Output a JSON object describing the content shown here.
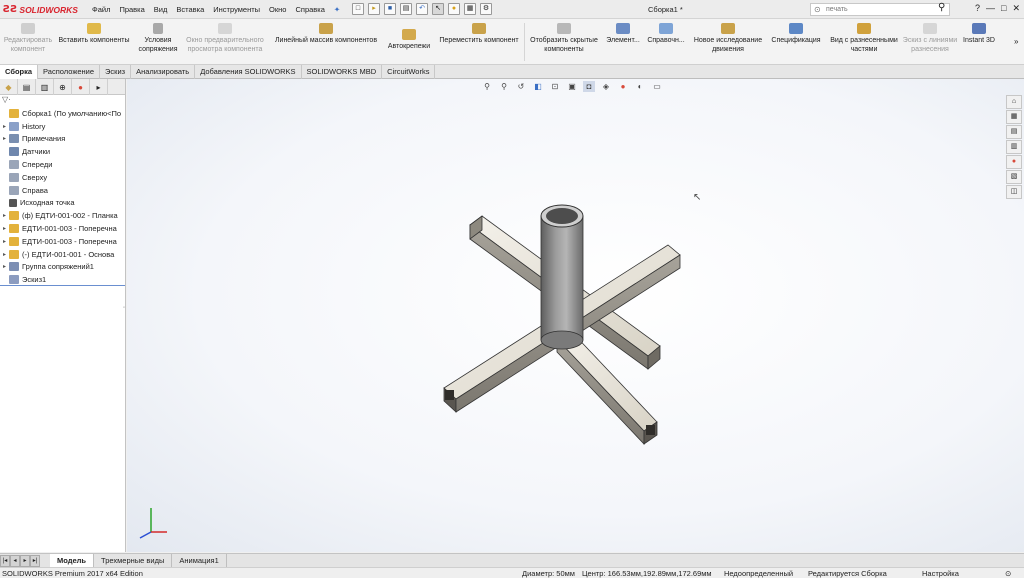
{
  "app": {
    "logo_text": "SOLIDWORKS",
    "doc_title": "Сборка1 *"
  },
  "menu": [
    "Файл",
    "Правка",
    "Вид",
    "Вставка",
    "Инструменты",
    "Окно",
    "Справка"
  ],
  "search": {
    "placeholder": "печать"
  },
  "window_controls": {
    "help": "?",
    "minimize": "—",
    "restore": "□",
    "close": "✕"
  },
  "ribbon": {
    "edit_component": "Редактировать компонент",
    "insert_components": "Вставить компоненты",
    "mate": "Условия сопряжения",
    "preview_window": "Окно предварительного просмотра компонента",
    "linear_pattern": "Линейный массив компонентов",
    "smart_fasteners": "Автокрепежи",
    "move_component": "Переместить компонент",
    "show_hidden": "Отобразить скрытые компоненты",
    "elements": "Элемент...",
    "reference": "Справочн...",
    "new_motion": "Новое исследование движения",
    "bom": "Спецификация",
    "exploded_view": "Вид с разнесенными частями",
    "explode_line": "Эскиз с линиями разнесения",
    "instant3d": "Instant 3D"
  },
  "command_tabs": [
    "Сборка",
    "Расположение",
    "Эскиз",
    "Анализировать",
    "Добавления SOLIDWORKS",
    "SOLIDWORKS MBD",
    "CircuitWorks"
  ],
  "tree": [
    {
      "label": "Сборка1  (По умолчанию<По",
      "arrow": "",
      "color": "#e3b23c"
    },
    {
      "label": "History",
      "arrow": "▸",
      "color": "#8aa0c8"
    },
    {
      "label": "Примечания",
      "arrow": "▸",
      "color": "#7a8fb0"
    },
    {
      "label": "Датчики",
      "arrow": "",
      "color": "#6f87ad"
    },
    {
      "label": "Спереди",
      "arrow": "",
      "color": "#9aa5b8"
    },
    {
      "label": "Сверху",
      "arrow": "",
      "color": "#9aa5b8"
    },
    {
      "label": "Справа",
      "arrow": "",
      "color": "#9aa5b8"
    },
    {
      "label": "Исходная точка",
      "arrow": "",
      "color": "#555555"
    },
    {
      "label": "(ф) ЕДТИ-001-002 - Планка",
      "arrow": "▸",
      "color": "#e3b23c"
    },
    {
      "label": "ЕДТИ-001-003 - Поперечна",
      "arrow": "▸",
      "color": "#e3b23c"
    },
    {
      "label": "ЕДТИ-001-003 - Поперечна",
      "arrow": "▸",
      "color": "#e3b23c"
    },
    {
      "label": "(-) ЕДТИ-001-001 - Основа",
      "arrow": "▸",
      "color": "#e3b23c"
    },
    {
      "label": "Группа сопряжений1",
      "arrow": "▸",
      "color": "#7d8fb4"
    },
    {
      "label": "Эскиз1",
      "arrow": "",
      "color": "#8c9cc0"
    }
  ],
  "bottom_tabs": [
    "Модель",
    "Трехмерные виды",
    "Анимация1"
  ],
  "status": {
    "edition": "SOLIDWORKS Premium 2017 x64 Edition",
    "diameter": "Диаметр: 50мм",
    "center": "Центр: 166.53мм,192.89мм,172.69мм",
    "definition": "Недоопределенный",
    "editing": "Редактируется Сборка",
    "settings": "Настройка"
  }
}
